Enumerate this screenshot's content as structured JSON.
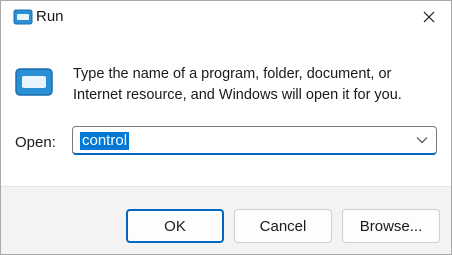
{
  "window": {
    "title": "Run"
  },
  "content": {
    "description": "Type the name of a program, folder, document, or Internet resource, and Windows will open it for you.",
    "open_label": "Open:",
    "open_value": "control"
  },
  "buttons": {
    "ok": "OK",
    "cancel": "Cancel",
    "browse": "Browse..."
  },
  "icons": {
    "title": "run-app-icon",
    "close": "close-icon",
    "main": "run-app-icon",
    "dropdown": "chevron-down-icon"
  },
  "colors": {
    "accent": "#0067c0",
    "selection": "#0078d4",
    "footer_bg": "#f3f3f3"
  }
}
